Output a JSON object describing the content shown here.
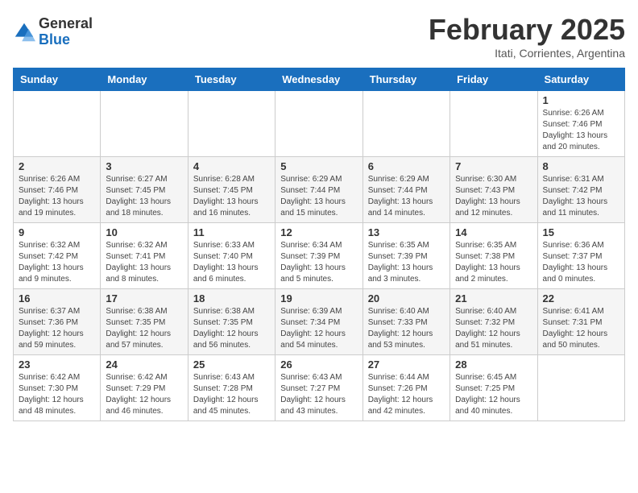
{
  "logo": {
    "general": "General",
    "blue": "Blue"
  },
  "title": "February 2025",
  "subtitle": "Itati, Corrientes, Argentina",
  "days_of_week": [
    "Sunday",
    "Monday",
    "Tuesday",
    "Wednesday",
    "Thursday",
    "Friday",
    "Saturday"
  ],
  "weeks": [
    [
      {
        "day": "",
        "info": ""
      },
      {
        "day": "",
        "info": ""
      },
      {
        "day": "",
        "info": ""
      },
      {
        "day": "",
        "info": ""
      },
      {
        "day": "",
        "info": ""
      },
      {
        "day": "",
        "info": ""
      },
      {
        "day": "1",
        "info": "Sunrise: 6:26 AM\nSunset: 7:46 PM\nDaylight: 13 hours\nand 20 minutes."
      }
    ],
    [
      {
        "day": "2",
        "info": "Sunrise: 6:26 AM\nSunset: 7:46 PM\nDaylight: 13 hours\nand 19 minutes."
      },
      {
        "day": "3",
        "info": "Sunrise: 6:27 AM\nSunset: 7:45 PM\nDaylight: 13 hours\nand 18 minutes."
      },
      {
        "day": "4",
        "info": "Sunrise: 6:28 AM\nSunset: 7:45 PM\nDaylight: 13 hours\nand 16 minutes."
      },
      {
        "day": "5",
        "info": "Sunrise: 6:29 AM\nSunset: 7:44 PM\nDaylight: 13 hours\nand 15 minutes."
      },
      {
        "day": "6",
        "info": "Sunrise: 6:29 AM\nSunset: 7:44 PM\nDaylight: 13 hours\nand 14 minutes."
      },
      {
        "day": "7",
        "info": "Sunrise: 6:30 AM\nSunset: 7:43 PM\nDaylight: 13 hours\nand 12 minutes."
      },
      {
        "day": "8",
        "info": "Sunrise: 6:31 AM\nSunset: 7:42 PM\nDaylight: 13 hours\nand 11 minutes."
      }
    ],
    [
      {
        "day": "9",
        "info": "Sunrise: 6:32 AM\nSunset: 7:42 PM\nDaylight: 13 hours\nand 9 minutes."
      },
      {
        "day": "10",
        "info": "Sunrise: 6:32 AM\nSunset: 7:41 PM\nDaylight: 13 hours\nand 8 minutes."
      },
      {
        "day": "11",
        "info": "Sunrise: 6:33 AM\nSunset: 7:40 PM\nDaylight: 13 hours\nand 6 minutes."
      },
      {
        "day": "12",
        "info": "Sunrise: 6:34 AM\nSunset: 7:39 PM\nDaylight: 13 hours\nand 5 minutes."
      },
      {
        "day": "13",
        "info": "Sunrise: 6:35 AM\nSunset: 7:39 PM\nDaylight: 13 hours\nand 3 minutes."
      },
      {
        "day": "14",
        "info": "Sunrise: 6:35 AM\nSunset: 7:38 PM\nDaylight: 13 hours\nand 2 minutes."
      },
      {
        "day": "15",
        "info": "Sunrise: 6:36 AM\nSunset: 7:37 PM\nDaylight: 13 hours\nand 0 minutes."
      }
    ],
    [
      {
        "day": "16",
        "info": "Sunrise: 6:37 AM\nSunset: 7:36 PM\nDaylight: 12 hours\nand 59 minutes."
      },
      {
        "day": "17",
        "info": "Sunrise: 6:38 AM\nSunset: 7:35 PM\nDaylight: 12 hours\nand 57 minutes."
      },
      {
        "day": "18",
        "info": "Sunrise: 6:38 AM\nSunset: 7:35 PM\nDaylight: 12 hours\nand 56 minutes."
      },
      {
        "day": "19",
        "info": "Sunrise: 6:39 AM\nSunset: 7:34 PM\nDaylight: 12 hours\nand 54 minutes."
      },
      {
        "day": "20",
        "info": "Sunrise: 6:40 AM\nSunset: 7:33 PM\nDaylight: 12 hours\nand 53 minutes."
      },
      {
        "day": "21",
        "info": "Sunrise: 6:40 AM\nSunset: 7:32 PM\nDaylight: 12 hours\nand 51 minutes."
      },
      {
        "day": "22",
        "info": "Sunrise: 6:41 AM\nSunset: 7:31 PM\nDaylight: 12 hours\nand 50 minutes."
      }
    ],
    [
      {
        "day": "23",
        "info": "Sunrise: 6:42 AM\nSunset: 7:30 PM\nDaylight: 12 hours\nand 48 minutes."
      },
      {
        "day": "24",
        "info": "Sunrise: 6:42 AM\nSunset: 7:29 PM\nDaylight: 12 hours\nand 46 minutes."
      },
      {
        "day": "25",
        "info": "Sunrise: 6:43 AM\nSunset: 7:28 PM\nDaylight: 12 hours\nand 45 minutes."
      },
      {
        "day": "26",
        "info": "Sunrise: 6:43 AM\nSunset: 7:27 PM\nDaylight: 12 hours\nand 43 minutes."
      },
      {
        "day": "27",
        "info": "Sunrise: 6:44 AM\nSunset: 7:26 PM\nDaylight: 12 hours\nand 42 minutes."
      },
      {
        "day": "28",
        "info": "Sunrise: 6:45 AM\nSunset: 7:25 PM\nDaylight: 12 hours\nand 40 minutes."
      },
      {
        "day": "",
        "info": ""
      }
    ]
  ]
}
